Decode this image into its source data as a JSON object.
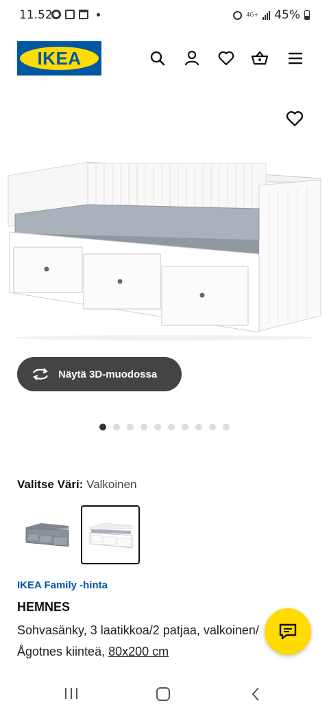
{
  "status_bar": {
    "time": "11.52",
    "network": "4G+",
    "battery": "45%"
  },
  "header": {
    "logo_text": "IKEA",
    "icons": [
      "search-icon",
      "user-icon",
      "heart-icon",
      "basket-icon",
      "menu-icon"
    ]
  },
  "product_image": {
    "favorite_icon": "heart-icon"
  },
  "view_3d": {
    "label": "Näytä 3D-muodossa",
    "icon": "rotate-icon"
  },
  "carousel": {
    "total": 10,
    "active_index": 0
  },
  "color": {
    "label": "Valitse Väri:",
    "value": "Valkoinen",
    "options": [
      "Harmaa",
      "Valkoinen"
    ],
    "selected_index": 1
  },
  "product": {
    "badge": "IKEA Family -hinta",
    "name": "HEMNES",
    "desc_line1": "Sohvasänky, 3 laatikkoa/2 patjaa, valkoinen/",
    "desc_line2_prefix": "Ågotnes kiinteä, ",
    "size": "80x200 cm"
  },
  "colors": {
    "ikea_blue": "#0058a3",
    "ikea_yellow": "#ffdb00",
    "button_dark": "#444444"
  },
  "chat": {
    "icon": "chat-icon"
  },
  "navbar": {
    "icons": [
      "recent-apps-icon",
      "home-icon",
      "back-icon"
    ]
  }
}
